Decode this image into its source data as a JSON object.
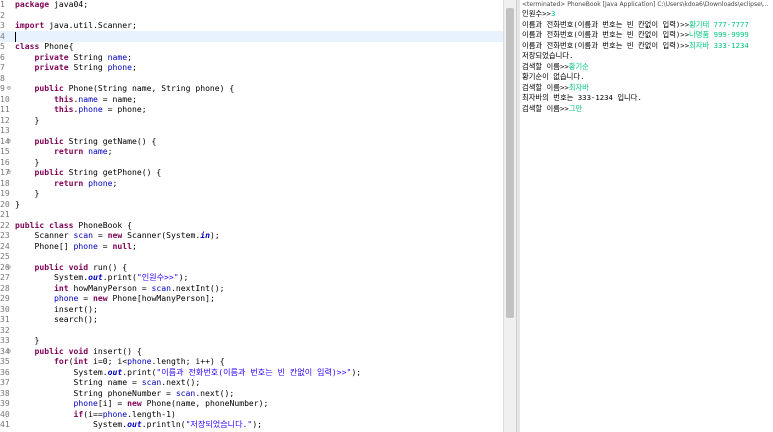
{
  "editor": {
    "lines": [
      {
        "n": "1",
        "fold": "",
        "html": "<span class='kw'>package</span> java04;"
      },
      {
        "n": "2",
        "fold": "",
        "html": ""
      },
      {
        "n": "3",
        "fold": "",
        "html": "<span class='kw'>import</span> java.util.Scanner;"
      },
      {
        "n": "4",
        "fold": "",
        "html": "",
        "current": true
      },
      {
        "n": "5",
        "fold": "",
        "html": "<span class='kw'>class</span> Phone{"
      },
      {
        "n": "6",
        "fold": "",
        "html": "    <span class='kw'>private</span> String <span class='fld'>name</span>;"
      },
      {
        "n": "7",
        "fold": "",
        "html": "    <span class='kw'>private</span> String <span class='fld'>phone</span>;"
      },
      {
        "n": "8",
        "fold": "",
        "html": ""
      },
      {
        "n": "9",
        "fold": "⊖",
        "html": "    <span class='kw'>public</span> Phone(String name, String phone) {"
      },
      {
        "n": "10",
        "fold": "",
        "html": "        <span class='kw'>this</span>.<span class='fld'>name</span> = name;"
      },
      {
        "n": "11",
        "fold": "",
        "html": "        <span class='kw'>this</span>.<span class='fld'>phone</span> = phone;"
      },
      {
        "n": "12",
        "fold": "",
        "html": "    }"
      },
      {
        "n": "13",
        "fold": "",
        "html": ""
      },
      {
        "n": "14",
        "fold": "⊖",
        "html": "    <span class='kw'>public</span> String getName() {"
      },
      {
        "n": "15",
        "fold": "",
        "html": "        <span class='kw'>return</span> <span class='fld'>name</span>;"
      },
      {
        "n": "16",
        "fold": "",
        "html": "    }"
      },
      {
        "n": "17",
        "fold": "⊖",
        "html": "    <span class='kw'>public</span> String getPhone() {"
      },
      {
        "n": "18",
        "fold": "",
        "html": "        <span class='kw'>return</span> <span class='fld'>phone</span>;"
      },
      {
        "n": "19",
        "fold": "",
        "html": "    }"
      },
      {
        "n": "20",
        "fold": "",
        "html": "}"
      },
      {
        "n": "21",
        "fold": "",
        "html": ""
      },
      {
        "n": "22",
        "fold": "",
        "html": "<span class='kw'>public</span> <span class='kw'>class</span> PhoneBook {"
      },
      {
        "n": "23",
        "fold": "",
        "html": "    Scanner <span class='fld'>scan</span> = <span class='kw'>new</span> Scanner(System.<span class='st'>in</span>);"
      },
      {
        "n": "24",
        "fold": "",
        "html": "    Phone[] <span class='fld'>phone</span> = <span class='kw'>null</span>;"
      },
      {
        "n": "25",
        "fold": "",
        "html": ""
      },
      {
        "n": "26",
        "fold": "⊖",
        "html": "    <span class='kw'>public</span> <span class='kw'>void</span> run() {"
      },
      {
        "n": "27",
        "fold": "",
        "html": "        System.<span class='st'>out</span>.print(<span class='str'>\"인원수>>\"</span>);"
      },
      {
        "n": "28",
        "fold": "",
        "html": "        <span class='kw'>int</span> howManyPerson = <span class='fld'>scan</span>.nextInt();"
      },
      {
        "n": "29",
        "fold": "",
        "html": "        <span class='fld'>phone</span> = <span class='kw'>new</span> Phone[howManyPerson];"
      },
      {
        "n": "30",
        "fold": "",
        "html": "        insert();"
      },
      {
        "n": "31",
        "fold": "",
        "html": "        search();"
      },
      {
        "n": "32",
        "fold": "",
        "html": ""
      },
      {
        "n": "33",
        "fold": "",
        "html": "    }"
      },
      {
        "n": "34",
        "fold": "⊖",
        "html": "    <span class='kw'>public</span> <span class='kw'>void</span> insert() {"
      },
      {
        "n": "35",
        "fold": "",
        "html": "        <span class='kw'>for</span>(<span class='kw'>int</span> i=0; i&lt;<span class='fld'>phone</span>.length; i++) {"
      },
      {
        "n": "36",
        "fold": "",
        "html": "            System.<span class='st'>out</span>.print(<span class='str'>\"이름과 전화번호(이름과 번호는 빈 칸없이 입력)>>\"</span>);"
      },
      {
        "n": "37",
        "fold": "",
        "html": "            String name = <span class='fld'>scan</span>.next();"
      },
      {
        "n": "38",
        "fold": "",
        "html": "            String phoneNumber = <span class='fld'>scan</span>.next();"
      },
      {
        "n": "39",
        "fold": "",
        "html": "            <span class='fld'>phone</span>[i] = <span class='kw'>new</span> Phone(name, phoneNumber);"
      },
      {
        "n": "40",
        "fold": "",
        "html": "            <span class='kw'>if</span>(i==<span class='fld'>phone</span>.length-1)"
      },
      {
        "n": "41",
        "fold": "",
        "html": "                System.<span class='st'>out</span>.println(<span class='str'>\"저장되었습니다.\"</span>);"
      }
    ]
  },
  "console": {
    "title": "<terminated> PhoneBook [Java Application] C:\\Users\\kdoa6\\Downloads\\eclipse\\...",
    "lines": [
      [
        {
          "t": "인원수>>"
        },
        {
          "t": "3",
          "in": true
        }
      ],
      [
        {
          "t": "이름과 전화번호(이름과 번호는 빈 칸없이 입력)>>"
        },
        {
          "t": "황기태 777-7777",
          "in": true
        }
      ],
      [
        {
          "t": "이름과 전화번호(이름과 번호는 빈 칸없이 입력)>>"
        },
        {
          "t": "나명품 999-9999",
          "in": true
        }
      ],
      [
        {
          "t": "이름과 전화번호(이름과 번호는 빈 칸없이 입력)>>"
        },
        {
          "t": "최자바 333-1234",
          "in": true
        }
      ],
      [
        {
          "t": "저장되었습니다."
        }
      ],
      [
        {
          "t": "검색할 이름>>"
        },
        {
          "t": "황기순",
          "in": true
        }
      ],
      [
        {
          "t": "황기순이 없습니다."
        }
      ],
      [
        {
          "t": "검색할 이름>>"
        },
        {
          "t": "최자바",
          "in": true
        }
      ],
      [
        {
          "t": "최자바의 번호는 333-1234 입니다."
        }
      ],
      [
        {
          "t": "검색할 이름>>"
        },
        {
          "t": "그만",
          "in": true
        }
      ]
    ]
  },
  "colors": {
    "keyword": "#7f0055",
    "field": "#0000c0",
    "string": "#2a00ff",
    "console_input": "#00c87d"
  }
}
